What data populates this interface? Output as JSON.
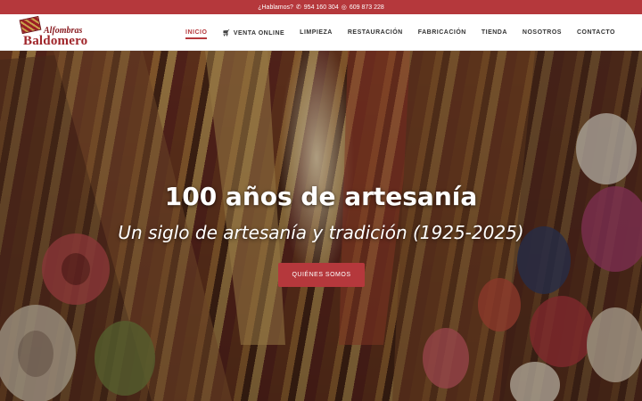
{
  "topbar": {
    "prefix": "¿Hablamos?",
    "phone_icon": "phone-icon",
    "phone": "954 160 304",
    "whatsapp_icon": "whatsapp-icon",
    "mobile": "609 873 228"
  },
  "logo": {
    "line1": "Alfombras",
    "line2": "Baldomero"
  },
  "nav": {
    "items": [
      {
        "label": "INICIO",
        "active": true
      },
      {
        "label": "VENTA ONLINE",
        "icon": "cart-icon"
      },
      {
        "label": "LIMPIEZA"
      },
      {
        "label": "RESTAURACIÓN"
      },
      {
        "label": "FABRICACIÓN"
      },
      {
        "label": "TIENDA"
      },
      {
        "label": "NOSOTROS"
      },
      {
        "label": "CONTACTO"
      }
    ]
  },
  "hero": {
    "title": "100 años de artesanía",
    "subtitle": "Un siglo de artesanía y tradición (1925-2025)",
    "button": "QUIÉNES SOMOS"
  },
  "colors": {
    "accent": "#b5383c"
  }
}
